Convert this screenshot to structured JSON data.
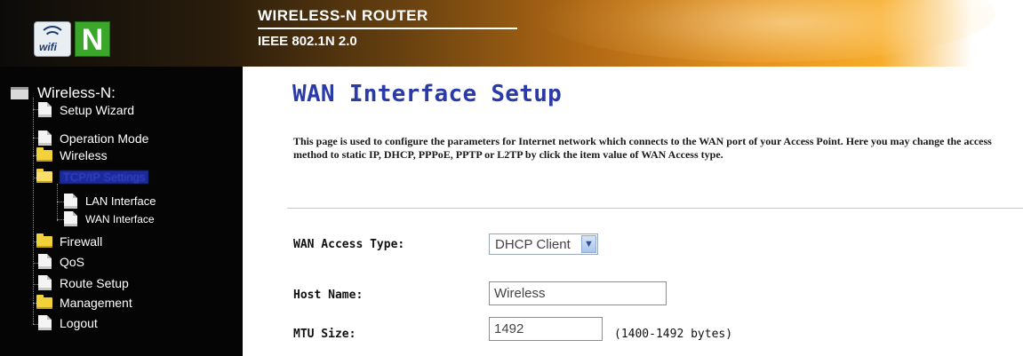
{
  "banner": {
    "product_name": "WIRELESS-N ROUTER",
    "standard": "IEEE 802.1N 2.0",
    "logo_text": "wifi",
    "logo_letter": "N"
  },
  "sidebar": {
    "root_label": "Wireless-N:",
    "items": [
      {
        "label": "Setup Wizard",
        "icon": "document-icon"
      },
      {
        "label": "Operation Mode",
        "icon": "document-icon"
      },
      {
        "label": "Wireless",
        "icon": "folder-icon"
      },
      {
        "label": "TCP/IP Settings",
        "icon": "folder-open-icon",
        "selected": true
      },
      {
        "label": "LAN Interface",
        "icon": "document-icon"
      },
      {
        "label": "WAN Interface",
        "icon": "document-icon"
      },
      {
        "label": "Firewall",
        "icon": "folder-icon"
      },
      {
        "label": "QoS",
        "icon": "document-icon"
      },
      {
        "label": "Route Setup",
        "icon": "document-icon"
      },
      {
        "label": "Management",
        "icon": "folder-icon"
      },
      {
        "label": "Logout",
        "icon": "document-icon"
      }
    ]
  },
  "main": {
    "title": "WAN Interface Setup",
    "description": "This page is used to configure the parameters for Internet network which connects to the WAN port of your Access Point. Here you may change the access method to static IP, DHCP, PPPoE, PPTP or L2TP by click the item value of WAN Access type.",
    "wan_access_type": {
      "label": "WAN Access Type:",
      "value": "DHCP Client"
    },
    "host_name": {
      "label": "Host Name:",
      "value": "Wireless"
    },
    "mtu_size": {
      "label": "MTU Size:",
      "value": "1492",
      "hint": "(1400-1492 bytes)"
    }
  },
  "colors": {
    "title_blue": "#2a3aa8",
    "sidebar_bg": "#050505",
    "banner_orange": "#f7ac2a",
    "logo_green": "#3aa62a"
  }
}
